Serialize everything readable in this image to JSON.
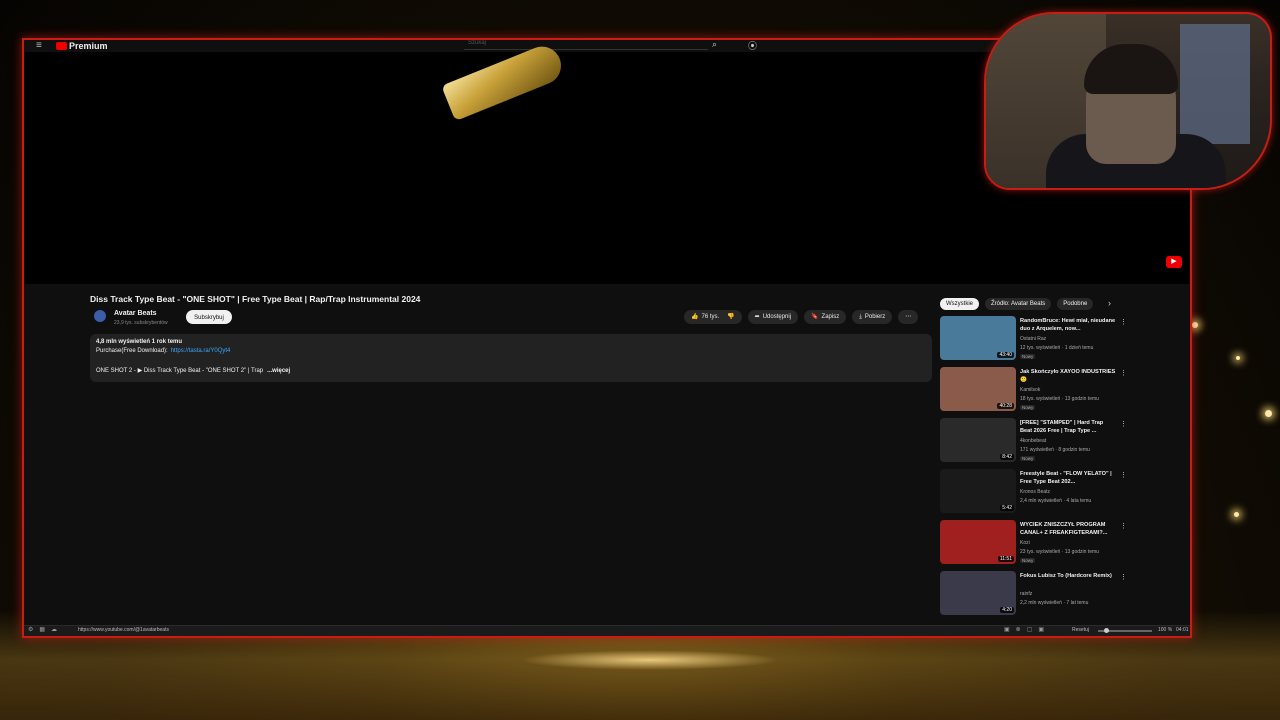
{
  "browser": {
    "logo_text": "Premium",
    "search_placeholder": "Szukaj",
    "status_url": "https://www.youtube.com/@1avatarbeats",
    "reset_label": "Resetuj",
    "zoom": "100 %",
    "time": "04:01"
  },
  "video": {
    "title": "Diss Track Type Beat - \"ONE SHOT\" | Free Type Beat | Rap/Trap Instrumental 2024",
    "channel_name": "Avatar Beats",
    "channel_subs": "23,9 tys. subskrybentów",
    "subscribe_label": "Subskrybuj",
    "likes": "76 tys.",
    "share_label": "Udostępnij",
    "save_label": "Zapisz",
    "download_label": "Pobierz",
    "description": {
      "views_time": "4,8 mln wyświetleń  1 rok temu",
      "purchase_text": "Purchase(Free Download):",
      "purchase_link": "https://tasta.ra/Y0Qyt4",
      "more_text": "ONE SHOT 2 - ▶ Diss Track Type Beat - \"ONE SHOT 2\" | Trap",
      "more_label": "...więcej"
    }
  },
  "sidebar": {
    "chips": [
      "Wszystkie",
      "Źródło: Avatar Beats",
      "Podobne"
    ],
    "recommendations": [
      {
        "title": "RandomBruce: Hewi miał, nieudane duo z Arquelem, now...",
        "channel": "Ostatni Raz",
        "meta": "12 tys. wyświetleń · 1 dzień temu",
        "badge": "Nowy",
        "duration": "43:40",
        "thumb_color": "#4a7a9a"
      },
      {
        "title": "Jak Skończyło XAYOO INDUSTRIES 🙁",
        "channel": "Kamilsok",
        "meta": "18 tys. wyświetleń · 13 godzin temu",
        "badge": "Nowy",
        "duration": "40:28",
        "thumb_color": "#8a5a4a"
      },
      {
        "title": "[FREE] \"STAMPED\" | Hard Trap Beat 2026 Free | Trap Type ...",
        "channel": "4konbebeat",
        "meta": "171 wyświetleń · 8 godzin temu",
        "badge": "Nowy",
        "duration": "8:42",
        "thumb_color": "#2a2a2a"
      },
      {
        "title": "Freestyle Beat - \"FLOW YELATO\" | Free Type Beat 202...",
        "channel": "Kronos Beatz",
        "meta": "2,4 mln wyświetleń · 4 lata temu",
        "badge": "",
        "duration": "5:42",
        "thumb_color": "#1a1a1a"
      },
      {
        "title": "WYCIEK ZNISZCZYŁ PROGRAM CANAL+ Z FREAKFIGTERAMI?...",
        "channel": "Kozi",
        "meta": "23 tys. wyświetleń · 13 godzin temu",
        "badge": "Nowy",
        "duration": "11:51",
        "thumb_color": "#a02020"
      },
      {
        "title": "Fokus Lubisz To (Hardcore Remix)",
        "channel": "rainfz",
        "meta": "2,2 mln wyświetleń · 7 lat temu",
        "badge": "",
        "duration": "4:20",
        "thumb_color": "#3a3a4a"
      }
    ]
  }
}
